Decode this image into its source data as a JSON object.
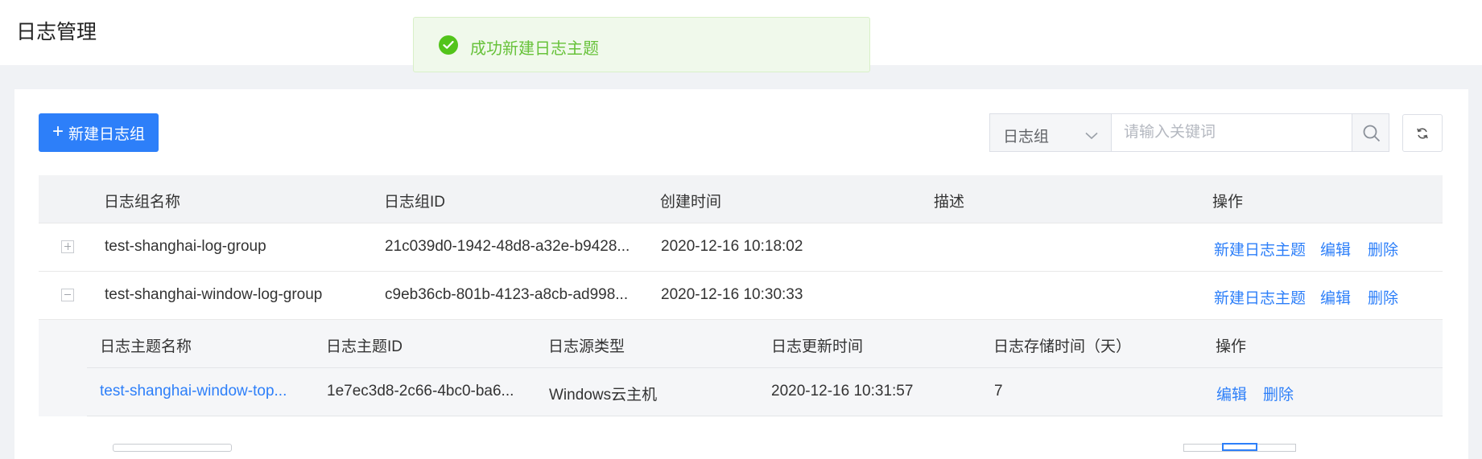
{
  "page": {
    "title": "日志管理"
  },
  "toast": {
    "message": "成功新建日志主题",
    "icon": "check-circle-icon",
    "color": "#67c23a"
  },
  "toolbar": {
    "create_button_label": "新建日志组",
    "filter_select_value": "日志组",
    "search_placeholder": "请输入关键词"
  },
  "table": {
    "columns": [
      "日志组名称",
      "日志组ID",
      "创建时间",
      "描述",
      "操作"
    ],
    "rows": [
      {
        "name": "test-shanghai-log-group",
        "id": "21c039d0-1942-48d8-a32e-b9428...",
        "created": "2020-12-16 10:18:02",
        "description": "",
        "expanded": false,
        "actions": [
          "新建日志主题",
          "编辑",
          "删除"
        ]
      },
      {
        "name": "test-shanghai-window-log-group",
        "id": "c9eb36cb-801b-4123-a8cb-ad998...",
        "created": "2020-12-16 10:30:33",
        "description": "",
        "expanded": true,
        "actions": [
          "新建日志主题",
          "编辑",
          "删除"
        ]
      }
    ]
  },
  "subtable": {
    "columns": [
      "日志主题名称",
      "日志主题ID",
      "日志源类型",
      "日志更新时间",
      "日志存储时间（天）",
      "操作"
    ],
    "rows": [
      {
        "name": "test-shanghai-window-top...",
        "id": "1e7ec3d8-2c66-4bc0-ba6...",
        "source_type": "Windows云主机",
        "updated": "2020-12-16 10:31:57",
        "retention_days": "7",
        "actions": [
          "编辑",
          "删除"
        ]
      }
    ]
  },
  "colors": {
    "primary": "#2d7ff9",
    "success": "#52c41a"
  }
}
